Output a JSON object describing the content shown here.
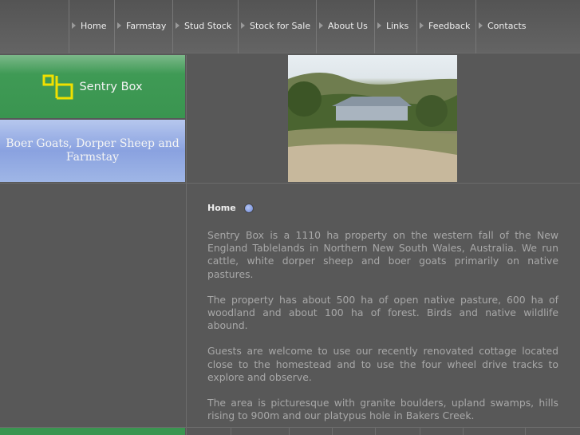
{
  "nav": {
    "items": [
      "Home",
      "Farmstay",
      "Stud Stock",
      "Stock for Sale",
      "About Us",
      "Links",
      "Feedback",
      "Contacts"
    ]
  },
  "brand": {
    "name": "Sentry Box",
    "tagline": "Boer Goats, Dorper Sheep and Farmstay",
    "logo_color": "#f0e000"
  },
  "content": {
    "title": "Home",
    "paragraphs": [
      "Sentry Box is a 1110 ha property on the western fall of the New England Tablelands in Northern New South Wales, Australia.  We run cattle, white dorper sheep and boer goats primarily on native pastures.",
      "The property has about 500 ha of open native pasture, 600 ha of woodland and about 100 ha of forest.  Birds and native wildlife abound.",
      "Guests are welcome to use our recently renovated cottage located close to the homestead and to use the four wheel drive tracks to explore and observe.",
      "The area is picturesque with granite boulders, upland swamps, hills rising to 900m and our platypus hole in Bakers Creek."
    ]
  }
}
